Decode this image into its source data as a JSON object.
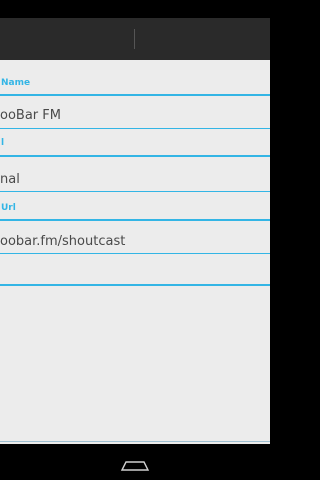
{
  "form": {
    "name_label": "Name",
    "name_value": "ooBar FM",
    "url_label": "l",
    "url_value": "nal",
    "stream_label": "Url",
    "stream_value": "oobar.fm/shoutcast"
  },
  "nav": {
    "home_icon": "home-icon"
  },
  "colors": {
    "accent": "#33b5e5",
    "content_bg": "#ececec",
    "action_bar": "#2a2a2a"
  }
}
